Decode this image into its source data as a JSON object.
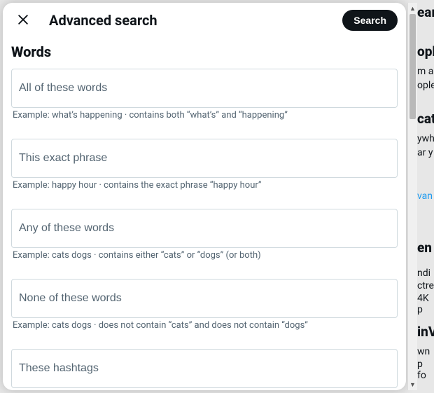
{
  "modal": {
    "title": "Advanced search",
    "close_aria": "Close",
    "search_btn": "Search"
  },
  "section": {
    "heading": "Words"
  },
  "fields": [
    {
      "label": "All of these words",
      "hint": "Example: what’s happening · contains both “what’s” and “happening”"
    },
    {
      "label": "This exact phrase",
      "hint": "Example: happy hour · contains the exact phrase “happy hour”"
    },
    {
      "label": "Any of these words",
      "hint": "Example: cats dogs · contains either “cats” or “dogs” (or both)"
    },
    {
      "label": "None of these words",
      "hint": "Example: cats dogs · does not contain “cats” and does not contain “dogs”"
    },
    {
      "label": "These hashtags",
      "hint": ""
    }
  ],
  "bg": {
    "h1": "ear",
    "h2": "opl",
    "l1": "m a",
    "l2": "ople",
    "h3": "cat",
    "l3": "ywh",
    "l4": "ar y",
    "link": "van",
    "h4": "en",
    "l5": "ndi",
    "l6": "ctre",
    "l7": "4K p",
    "h5": "inV",
    "l8": "wn",
    "l9": "p fo"
  }
}
